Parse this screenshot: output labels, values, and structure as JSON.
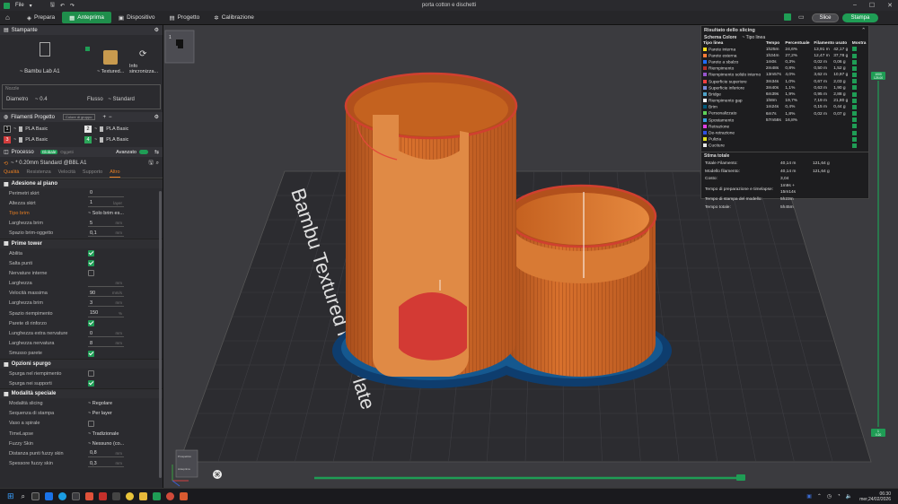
{
  "titlebar": {
    "menu_file": "File",
    "title": "porta cotton e dischetti"
  },
  "toolbar": {
    "tabs": [
      {
        "label": "Prepara"
      },
      {
        "label": "Anteprima"
      },
      {
        "label": "Dispositivo"
      },
      {
        "label": "Progetto"
      },
      {
        "label": "Calibrazione"
      }
    ],
    "slice": "Slice",
    "print": "Stampa"
  },
  "printer": {
    "section": "Stampante",
    "name": "Bambu Lab A1",
    "plate": "Textured...",
    "sync": "Info sincronizza...",
    "nozzle_section": "Nozzle",
    "diameter_label": "Diametro",
    "diameter": "0.4",
    "flow_label": "Flusso",
    "flow": "Standard"
  },
  "filaments": {
    "section": "Filamenti Progetto",
    "button": "Colore di gruppo",
    "items": [
      {
        "num": "1",
        "name": "PLA Basic",
        "color": "#111111"
      },
      {
        "num": "2",
        "name": "PLA Basic",
        "color": "#e8e8e8"
      },
      {
        "num": "3",
        "name": "PLA Basic",
        "color": "#d23c3c"
      },
      {
        "num": "4",
        "name": "PLA Basic",
        "color": "#2ca65a"
      }
    ]
  },
  "process": {
    "section": "Processo",
    "global": "Globale",
    "objects": "Oggetti",
    "advanced": "Avanzato",
    "profile": "* 0.20mm Standard @BBL A1",
    "tabs": [
      "Qualità",
      "Resistenza",
      "Velocità",
      "Supporto",
      "Altro"
    ]
  },
  "groups": [
    {
      "title": "Adesione al piano",
      "rows": [
        {
          "label": "Perimetri skirt",
          "kind": "input",
          "value": "0",
          "unit": ""
        },
        {
          "label": "Altezza skirt",
          "kind": "input",
          "value": "1",
          "unit": "layer"
        },
        {
          "label": "Tipo brim",
          "kind": "select",
          "value": "Solo brim es...",
          "unit": "",
          "orange": true
        },
        {
          "label": "Larghezza brim",
          "kind": "input",
          "value": "5",
          "unit": "mm"
        },
        {
          "label": "Spazio brim-oggetto",
          "kind": "input",
          "value": "0,1",
          "unit": "mm"
        }
      ]
    },
    {
      "title": "Prime tower",
      "rows": [
        {
          "label": "Abilita",
          "kind": "check",
          "value": "",
          "unit": ""
        },
        {
          "label": "Salta punti",
          "kind": "check",
          "value": "",
          "unit": ""
        },
        {
          "label": "Nervature interne",
          "kind": "box",
          "value": "",
          "unit": ""
        },
        {
          "label": "Larghezza",
          "kind": "input",
          "value": "",
          "unit": "mm"
        },
        {
          "label": "Velocità massima",
          "kind": "input",
          "value": "90",
          "unit": "mm/s"
        },
        {
          "label": "Larghezza brim",
          "kind": "input",
          "value": "3",
          "unit": "mm"
        },
        {
          "label": "Spazio riempimento",
          "kind": "input",
          "value": "150",
          "unit": "%"
        },
        {
          "label": "Parete di rinforzo",
          "kind": "check",
          "value": "",
          "unit": ""
        },
        {
          "label": "Lunghezza extra nervature",
          "kind": "input",
          "value": "0",
          "unit": "mm"
        },
        {
          "label": "Larghezza nervatura",
          "kind": "input",
          "value": "8",
          "unit": "mm"
        },
        {
          "label": "Smusso parete",
          "kind": "check",
          "value": "",
          "unit": ""
        }
      ]
    },
    {
      "title": "Opzioni spurgo",
      "rows": [
        {
          "label": "Spurga nel riempimento",
          "kind": "box",
          "value": "",
          "unit": ""
        },
        {
          "label": "Spurga nei supporti",
          "kind": "check",
          "value": "",
          "unit": ""
        }
      ]
    },
    {
      "title": "Modalità speciale",
      "rows": [
        {
          "label": "Modalità slicing",
          "kind": "select",
          "value": "Regolare",
          "unit": ""
        },
        {
          "label": "Sequenza di stampa",
          "kind": "select",
          "value": "Per layer",
          "unit": ""
        },
        {
          "label": "Vaso a spirale",
          "kind": "box",
          "value": "",
          "unit": ""
        },
        {
          "label": "TimeLapse",
          "kind": "select",
          "value": "Tradizionale",
          "unit": ""
        },
        {
          "label": "Fuzzy Skin",
          "kind": "select",
          "value": "Nessuno (co...",
          "unit": ""
        },
        {
          "label": "Distanza punti fuzzy skin",
          "kind": "input",
          "value": "0,8",
          "unit": "mm"
        },
        {
          "label": "Spessore fuzzy skin",
          "kind": "input",
          "value": "0,3",
          "unit": "mm"
        }
      ]
    }
  ],
  "viewport": {
    "plate_label": "Bambu Textured PEI Plate",
    "plate_num": "1",
    "layer_top_a": "1000",
    "layer_top_b": "125.00",
    "layer_bottom_a": "1",
    "layer_bottom_b": "0.20",
    "view_lbl1": "Prospettico",
    "view_lbl2": "Anteprima"
  },
  "results": {
    "title": "Risultato dello slicing",
    "scheme_label": "Schema Colore",
    "scheme": "Tipo linea",
    "headers": [
      "Tipo linea",
      "Tempo",
      "Percentuale",
      "Filamento usato",
      "Mostra"
    ],
    "rows": [
      {
        "name": "Parete interna",
        "color": "#ffe11f",
        "time": "1h25m",
        "pct": "24,6%",
        "fil": "13,91 m",
        "g": "42,17 g"
      },
      {
        "name": "Parete esterna",
        "color": "#ff7d38",
        "time": "1h34m",
        "pct": "27,2%",
        "fil": "12,47 m",
        "g": "37,78 g"
      },
      {
        "name": "Parete a sbalzo",
        "color": "#1f6dff",
        "time": "1m0s",
        "pct": "0,3%",
        "fil": "0,02 m",
        "g": "0,06 g"
      },
      {
        "name": "Riempimento",
        "color": "#b03029",
        "time": "2m48s",
        "pct": "0,8%",
        "fil": "0,50 m",
        "g": "1,52 g"
      },
      {
        "name": "Riempimento solido interno",
        "color": "#9654cc",
        "time": "13m57s",
        "pct": "4,0%",
        "fil": "3,62 m",
        "g": "10,97 g"
      },
      {
        "name": "Superficie superiore",
        "color": "#f04040",
        "time": "3m34s",
        "pct": "1,0%",
        "fil": "0,67 m",
        "g": "2,03 g"
      },
      {
        "name": "Superficie inferiore",
        "color": "#7a89d9",
        "time": "3m40s",
        "pct": "1,1%",
        "fil": "0,63 m",
        "g": "1,90 g"
      },
      {
        "name": "Bridge",
        "color": "#4fa3c7",
        "time": "6m39s",
        "pct": "1,9%",
        "fil": "0,95 m",
        "g": "2,88 g"
      },
      {
        "name": "Riempimento gap",
        "color": "#ffffff",
        "time": "1h8m",
        "pct": "19,7%",
        "fil": "7,19 m",
        "g": "21,80 g"
      },
      {
        "name": "Brim",
        "color": "#00587a",
        "time": "1m24s",
        "pct": "0,4%",
        "fil": "0,15 m",
        "g": "0,44 g"
      },
      {
        "name": "Personalizzato",
        "color": "#5ed15a",
        "time": "6m7s",
        "pct": "1,8%",
        "fil": "0,02 m",
        "g": "0,07 g"
      },
      {
        "name": "Spostamento",
        "color": "#3aa0e0",
        "time": "57m58s",
        "pct": "16,8%",
        "fil": "",
        "g": ""
      },
      {
        "name": "Retrazione",
        "color": "#e040e0",
        "time": "",
        "pct": "",
        "fil": "",
        "g": ""
      },
      {
        "name": "De-retrazione",
        "color": "#3050e0",
        "time": "",
        "pct": "",
        "fil": "",
        "g": ""
      },
      {
        "name": "Pulizia",
        "color": "#e0e020",
        "time": "",
        "pct": "",
        "fil": "",
        "g": ""
      },
      {
        "name": "Cuciture",
        "color": "#e6e6e6",
        "time": "",
        "pct": "",
        "fil": "",
        "g": ""
      }
    ],
    "est_title": "Stima totale",
    "est": [
      {
        "label": "Totale Filamento:",
        "a": "40,14 m",
        "b": "121,64 g"
      },
      {
        "label": "Modello filamento:",
        "a": "40,14 m",
        "b": "121,64 g"
      },
      {
        "label": "Costo:",
        "a": "3,04",
        "b": ""
      },
      {
        "label": "Tempo di preparazione e timelapse:",
        "a": "1m9s + 15m14s",
        "b": ""
      },
      {
        "label": "Tempo di stampa del modello:",
        "a": "5h23m",
        "b": ""
      },
      {
        "label": "Tempo totale:",
        "a": "5h45m",
        "b": ""
      }
    ]
  },
  "taskbar": {
    "time": "06:30",
    "date": "mer,24/02/2026"
  }
}
